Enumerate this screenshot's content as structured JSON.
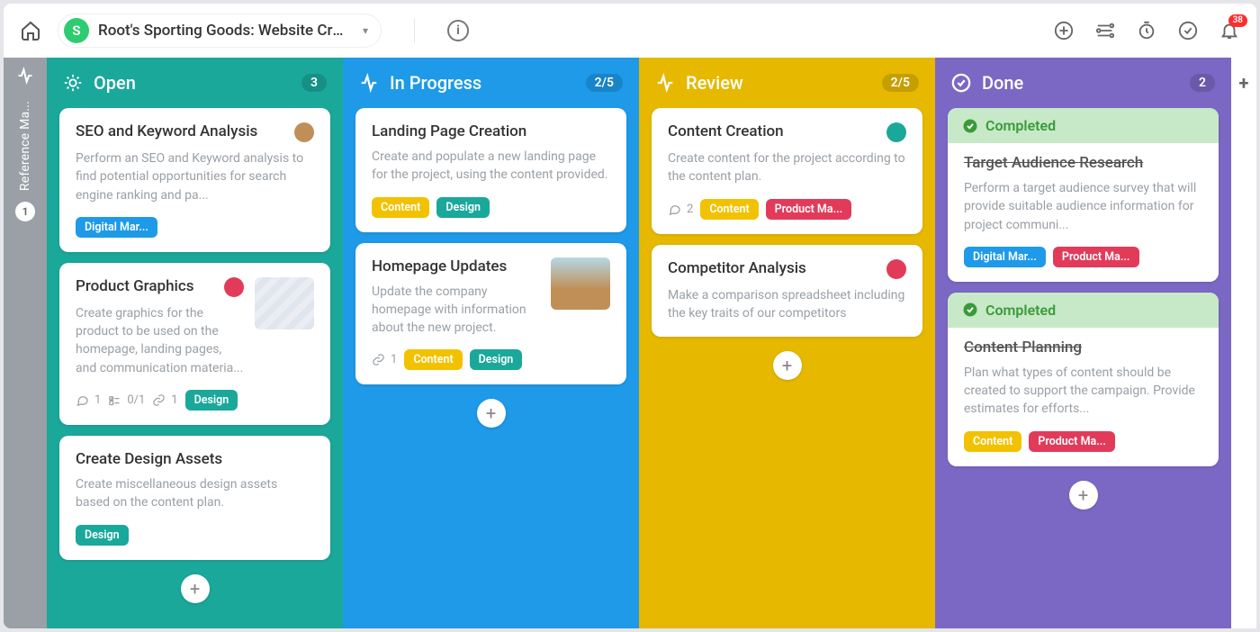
{
  "topbar": {
    "project_initial": "S",
    "project_title": "Root's Sporting Goods: Website Cre...",
    "notification_count": "38"
  },
  "sidebar": {
    "label": "Reference Ma...",
    "count": "1"
  },
  "columns": [
    {
      "key": "open",
      "title": "Open",
      "count": "3",
      "cards": [
        {
          "title": "SEO and Keyword Analysis",
          "desc": "Perform an SEO and Keyword analysis to find potential opportunities for search engine ranking and pa...",
          "tags": [
            {
              "label": "Digital Mar...",
              "cls": "tag-blue"
            }
          ],
          "avatar": "#c08f58"
        },
        {
          "title": "Product Graphics",
          "desc": "Create graphics for the product to be used on the homepage, landing pages, and communication materia...",
          "meta": [
            {
              "icon": "chat",
              "val": "1"
            },
            {
              "icon": "check",
              "val": "0/1"
            },
            {
              "icon": "link",
              "val": "1"
            }
          ],
          "tags": [
            {
              "label": "Design",
              "cls": "tag-teal"
            }
          ],
          "avatar": "#e23b5a",
          "thumb": true
        },
        {
          "title": "Create Design Assets",
          "desc": "Create miscellaneous design assets based on the content plan.",
          "tags": [
            {
              "label": "Design",
              "cls": "tag-teal"
            }
          ]
        }
      ]
    },
    {
      "key": "progress",
      "title": "In Progress",
      "count": "2/5",
      "cards": [
        {
          "title": "Landing Page Creation",
          "desc": "Create and populate a new landing page for the project, using the content provided.",
          "tags": [
            {
              "label": "Content",
              "cls": "tag-yellow"
            },
            {
              "label": "Design",
              "cls": "tag-teal"
            }
          ]
        },
        {
          "title": "Homepage Updates",
          "desc": "Update the company homepage with information about the new project.",
          "meta": [
            {
              "icon": "link",
              "val": "1"
            }
          ],
          "tags": [
            {
              "label": "Content",
              "cls": "tag-yellow"
            },
            {
              "label": "Design",
              "cls": "tag-teal"
            }
          ],
          "thumb2": true
        }
      ]
    },
    {
      "key": "review",
      "title": "Review",
      "count": "2/5",
      "cards": [
        {
          "title": "Content Creation",
          "desc": "Create content for the project according to the content plan.",
          "meta": [
            {
              "icon": "chat",
              "val": "2"
            }
          ],
          "tags": [
            {
              "label": "Content",
              "cls": "tag-yellow"
            },
            {
              "label": "Product Ma...",
              "cls": "tag-red"
            }
          ],
          "avatar": "#1aa89b"
        },
        {
          "title": "Competitor Analysis",
          "desc": "Make a comparison spreadsheet including the key traits of our competitors",
          "avatar": "#e23b5a"
        }
      ]
    },
    {
      "key": "done",
      "title": "Done",
      "count": "2",
      "cards": [
        {
          "completed": true,
          "completed_label": "Completed",
          "title": "Target Audience Research",
          "strike": true,
          "desc": "Perform a target audience survey that will provide suitable audience information for project communi...",
          "tags": [
            {
              "label": "Digital Mar...",
              "cls": "tag-blue"
            },
            {
              "label": "Product Ma...",
              "cls": "tag-red"
            }
          ]
        },
        {
          "completed": true,
          "completed_label": "Completed",
          "title": "Content Planning",
          "strike": true,
          "desc": "Plan what types of content should be created to support the campaign. Provide estimates for efforts...",
          "tags": [
            {
              "label": "Content",
              "cls": "tag-yellow"
            },
            {
              "label": "Product Ma...",
              "cls": "tag-red"
            }
          ]
        }
      ]
    }
  ]
}
